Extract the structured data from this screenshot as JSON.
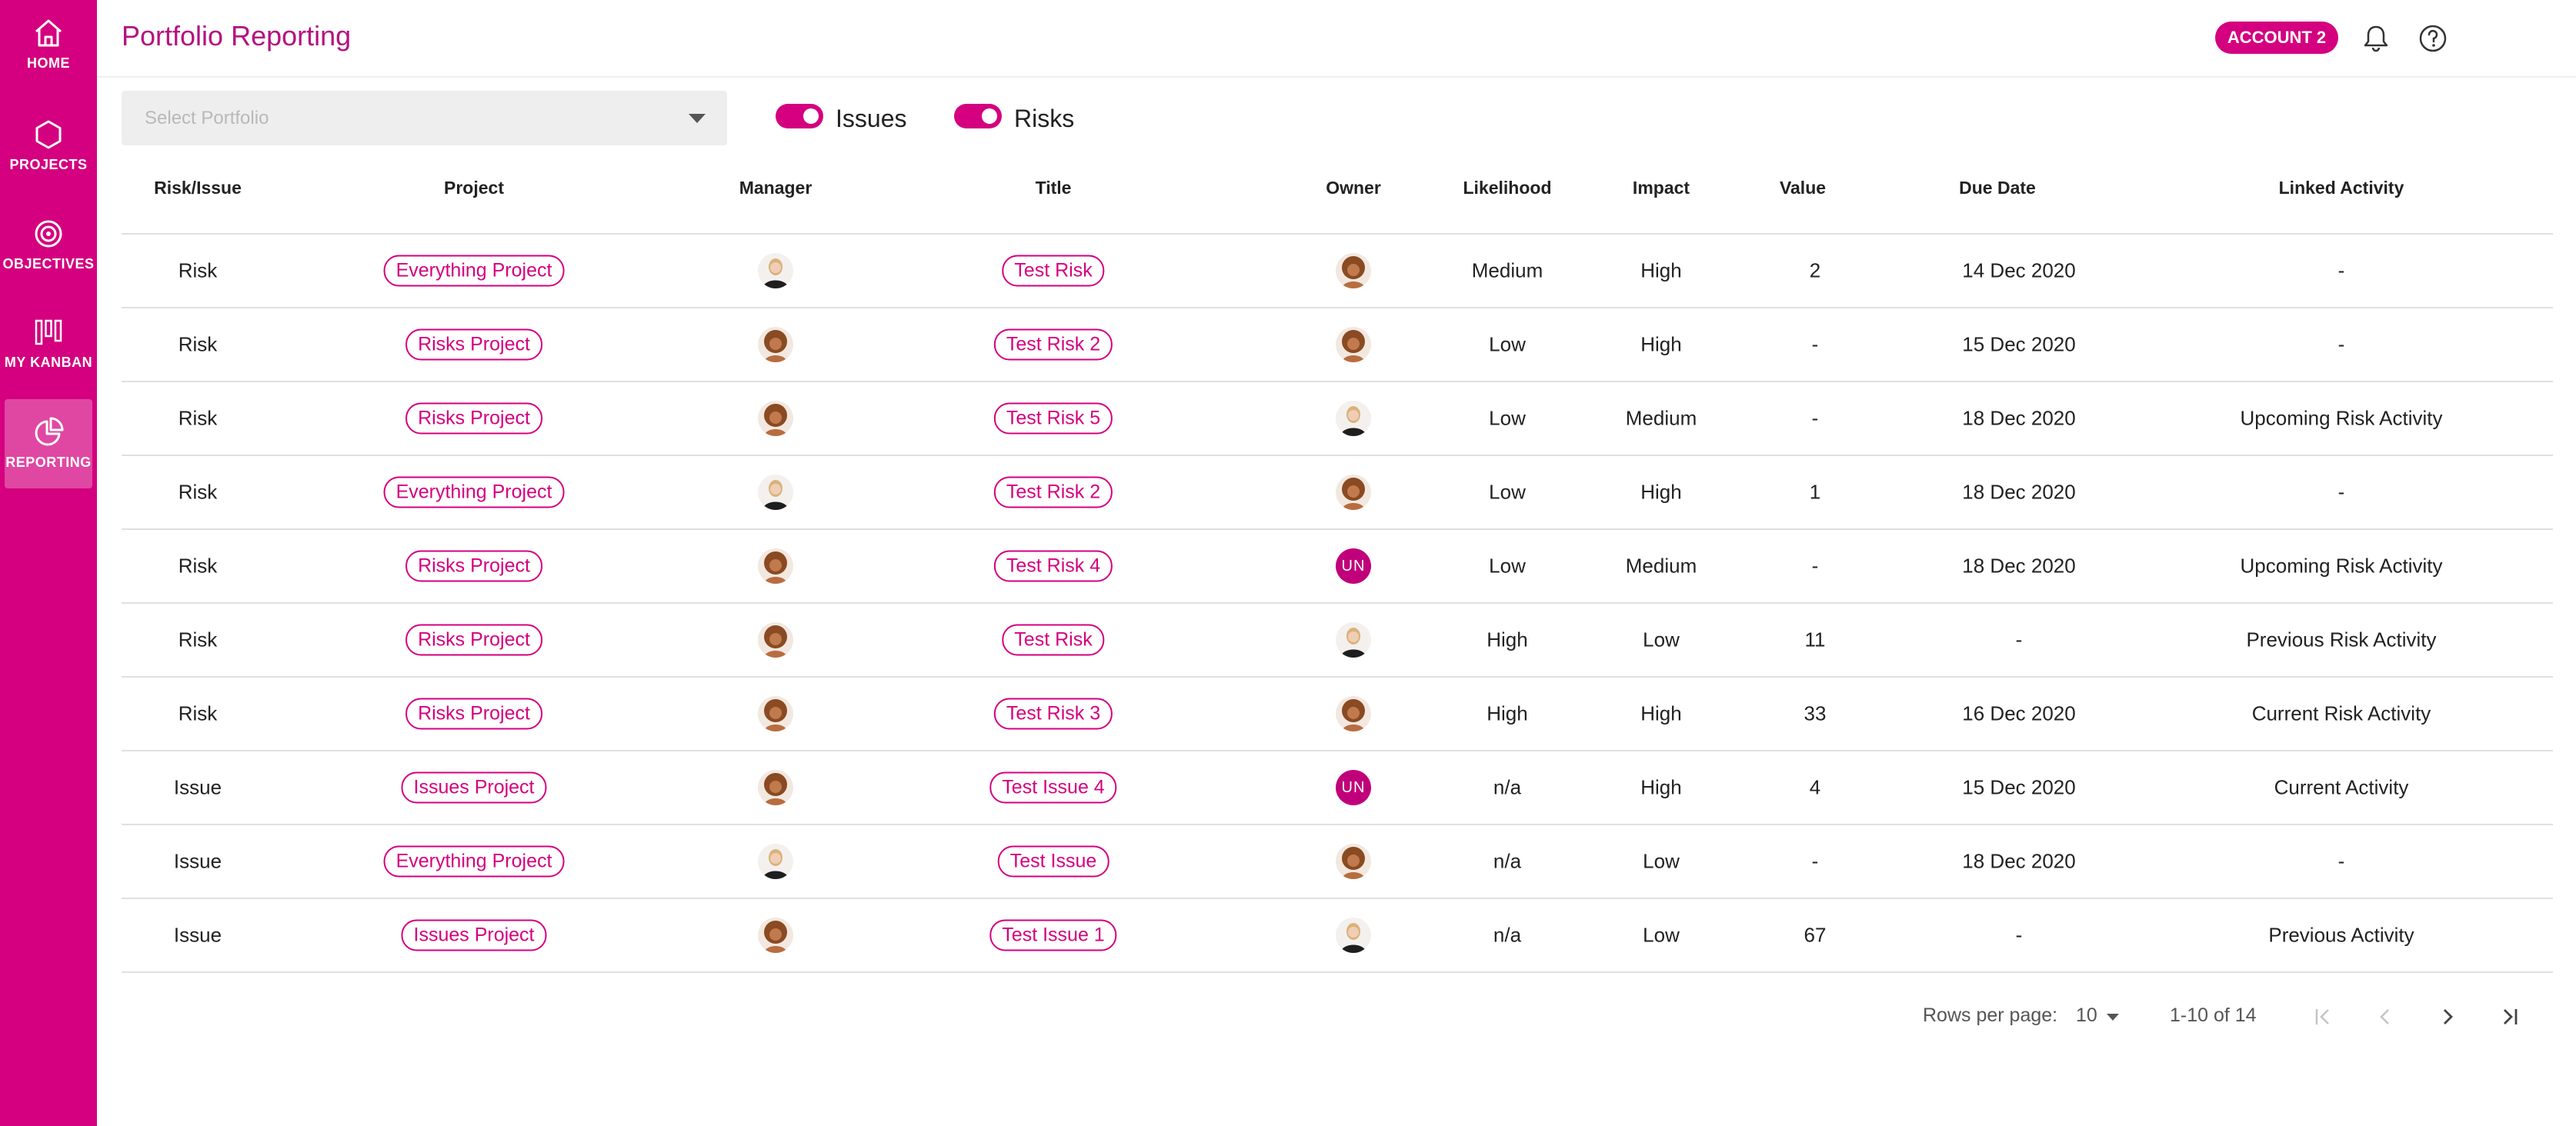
{
  "sidebar": {
    "items": [
      {
        "label": "HOME",
        "icon": "home-icon"
      },
      {
        "label": "PROJECTS",
        "icon": "hexagon-icon"
      },
      {
        "label": "OBJECTIVES",
        "icon": "target-icon"
      },
      {
        "label": "MY KANBAN",
        "icon": "kanban-icon"
      },
      {
        "label": "REPORTING",
        "icon": "pie-chart-icon",
        "active": true
      }
    ]
  },
  "header": {
    "title": "Portfolio Reporting",
    "account_label": "ACCOUNT 2"
  },
  "filters": {
    "select_placeholder": "Select Portfolio",
    "toggle_issues_label": "Issues",
    "toggle_risks_label": "Risks",
    "issues_enabled": true,
    "risks_enabled": true
  },
  "table": {
    "columns": [
      "Risk/Issue",
      "Project",
      "Manager",
      "Title",
      "Owner",
      "Likelihood",
      "Impact",
      "Value",
      "Due Date",
      "Linked Activity"
    ],
    "rows": [
      {
        "type": "Risk",
        "project": "Everything Project",
        "manager": "blonde",
        "title": "Test Risk",
        "owner": "curly",
        "likelihood": "Medium",
        "impact": "High",
        "value": "2",
        "due": "14 Dec 2020",
        "activity": "-"
      },
      {
        "type": "Risk",
        "project": "Risks Project",
        "manager": "curly",
        "title": "Test Risk 2",
        "owner": "curly",
        "likelihood": "Low",
        "impact": "High",
        "value": "-",
        "due": "15 Dec 2020",
        "activity": "-"
      },
      {
        "type": "Risk",
        "project": "Risks Project",
        "manager": "curly",
        "title": "Test Risk 5",
        "owner": "blonde",
        "likelihood": "Low",
        "impact": "Medium",
        "value": "-",
        "due": "18 Dec 2020",
        "activity": "Upcoming Risk Activity"
      },
      {
        "type": "Risk",
        "project": "Everything Project",
        "manager": "blonde",
        "title": "Test Risk 2",
        "owner": "curly",
        "likelihood": "Low",
        "impact": "High",
        "value": "1",
        "due": "18 Dec 2020",
        "activity": "-"
      },
      {
        "type": "Risk",
        "project": "Risks Project",
        "manager": "curly",
        "title": "Test Risk 4",
        "owner": "UN",
        "likelihood": "Low",
        "impact": "Medium",
        "value": "-",
        "due": "18 Dec 2020",
        "activity": "Upcoming Risk Activity"
      },
      {
        "type": "Risk",
        "project": "Risks Project",
        "manager": "curly",
        "title": "Test Risk",
        "owner": "blonde",
        "likelihood": "High",
        "impact": "Low",
        "value": "11",
        "due": "-",
        "activity": "Previous Risk Activity"
      },
      {
        "type": "Risk",
        "project": "Risks Project",
        "manager": "curly",
        "title": "Test Risk 3",
        "owner": "curly",
        "likelihood": "High",
        "impact": "High",
        "value": "33",
        "due": "16 Dec 2020",
        "activity": "Current Risk Activity"
      },
      {
        "type": "Issue",
        "project": "Issues Project",
        "manager": "curly",
        "title": "Test Issue 4",
        "owner": "UN",
        "likelihood": "n/a",
        "impact": "High",
        "value": "4",
        "due": "15 Dec 2020",
        "activity": "Current Activity"
      },
      {
        "type": "Issue",
        "project": "Everything Project",
        "manager": "blonde",
        "title": "Test Issue",
        "owner": "curly",
        "likelihood": "n/a",
        "impact": "Low",
        "value": "-",
        "due": "18 Dec 2020",
        "activity": "-"
      },
      {
        "type": "Issue",
        "project": "Issues Project",
        "manager": "curly",
        "title": "Test Issue 1",
        "owner": "blonde",
        "likelihood": "n/a",
        "impact": "Low",
        "value": "67",
        "due": "-",
        "activity": "Previous Activity"
      }
    ]
  },
  "pagination": {
    "rows_per_page_label": "Rows per page:",
    "rows_per_page": "10",
    "range": "1-10 of 14"
  },
  "colors": {
    "brand": "#d4007f",
    "title": "#b5127f",
    "owner_initials_bg": "#c0007a"
  }
}
